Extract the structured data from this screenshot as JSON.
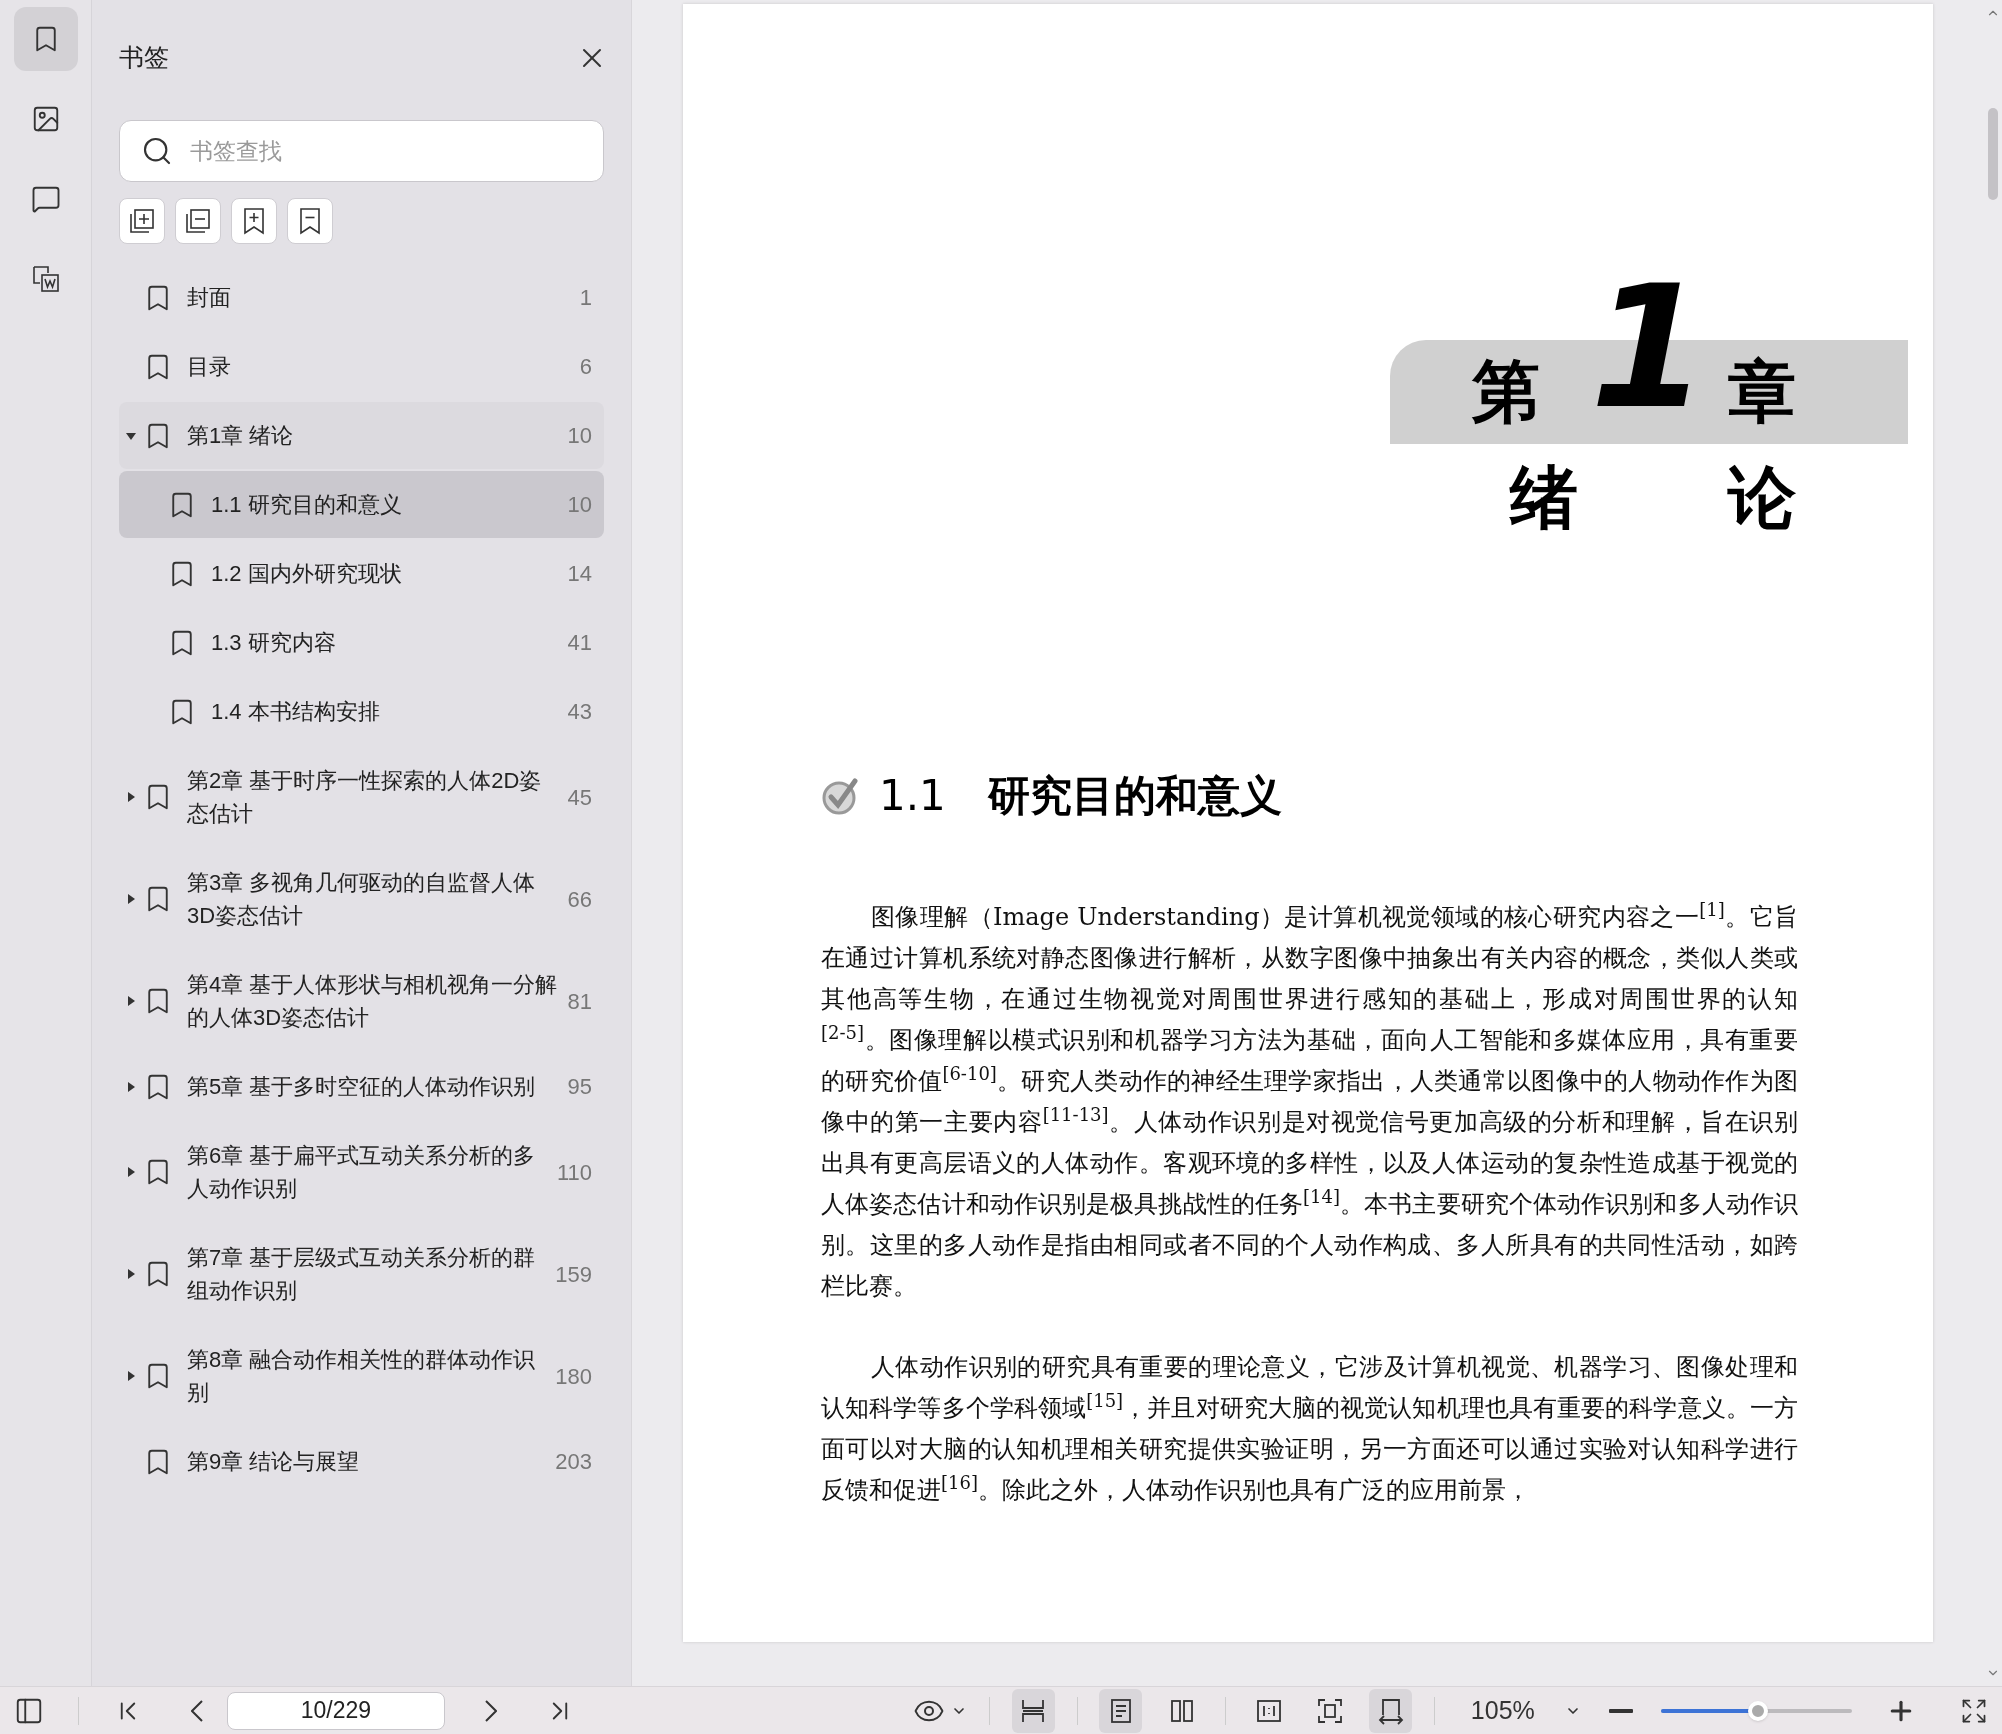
{
  "rail": [
    {
      "kind": "bookmarks",
      "selected": true
    },
    {
      "kind": "thumbnails",
      "selected": false
    },
    {
      "kind": "comments",
      "selected": false
    },
    {
      "kind": "convert",
      "selected": false
    }
  ],
  "sidebar": {
    "title": "书签",
    "search": {
      "placeholder": "书签查找"
    },
    "tools": [
      {
        "kind": "add-child"
      },
      {
        "kind": "remove-child"
      },
      {
        "kind": "add-bookmark"
      },
      {
        "kind": "remove-bookmark"
      }
    ],
    "items": [
      {
        "label": "封面",
        "page": "1",
        "selected": false,
        "highlighted": false
      },
      {
        "label": "目录",
        "page": "6",
        "selected": false,
        "highlighted": false
      },
      {
        "label": "第1章 绪论",
        "page": "10",
        "selected": false,
        "highlighted": true,
        "expanded": true,
        "children": [
          {
            "label": "1.1 研究目的和意义",
            "page": "10",
            "selected": true,
            "highlighted": false
          },
          {
            "label": "1.2 国内外研究现状",
            "page": "14",
            "selected": false,
            "highlighted": false
          },
          {
            "label": "1.3 研究内容",
            "page": "41",
            "selected": false,
            "highlighted": false
          },
          {
            "label": "1.4 本书结构安排",
            "page": "43",
            "selected": false,
            "highlighted": false
          }
        ]
      },
      {
        "label": "第2章 基于时序一性探索的人体2D姿态估计",
        "page": "45",
        "selected": false,
        "highlighted": false,
        "expanded": false
      },
      {
        "label": "第3章 多视角几何驱动的自监督人体3D姿态估计",
        "page": "66",
        "selected": false,
        "highlighted": false,
        "expanded": false
      },
      {
        "label": "第4章 基于人体形状与相机视角一分解的人体3D姿态估计",
        "page": "81",
        "selected": false,
        "highlighted": false,
        "expanded": false
      },
      {
        "label": "第5章 基于多时空征的人体动作识别",
        "page": "95",
        "selected": false,
        "highlighted": false,
        "expanded": false
      },
      {
        "label": "第6章 基于扁平式互动关系分析的多人动作识别",
        "page": "110",
        "selected": false,
        "highlighted": false,
        "expanded": false
      },
      {
        "label": "第7章 基于层级式互动关系分析的群组动作识别",
        "page": "159",
        "selected": false,
        "highlighted": false,
        "expanded": false
      },
      {
        "label": "第8章 融合动作相关性的群体动作识别",
        "page": "180",
        "selected": false,
        "highlighted": false,
        "expanded": false
      },
      {
        "label": "第9章 结论与展望",
        "page": "203",
        "selected": false,
        "highlighted": false
      }
    ]
  },
  "page": {
    "chapter_prefix": "第",
    "chapter_number": "1",
    "chapter_suffix": "章",
    "chapter_title": [
      "绪",
      "论"
    ],
    "section_number": "1.1",
    "section_title": "研究目的和意义",
    "paragraphs": [
      "图像理解（Image Understanding）是计算机视觉领域的核心研究内容之一$^{[1]}$。它旨在通过计算机系统对静态图像进行解析，从数字图像中抽象出有关内容的概念，类似人类或其他高等生物，在通过生物视觉对周围世界进行感知的基础上，形成对周围世界的认知$^{[2-5]}$。图像理解以模式识别和机器学习方法为基础，面向人工智能和多媒体应用，具有重要的研究价值$^{[6-10]}$。研究人类动作的神经生理学家指出，人类通常以图像中的人物动作作为图像中的第一主要内容$^{[11-13]}$。人体动作识别是对视觉信号更加高级的分析和理解，旨在识别出具有更高层语义的人体动作。客观环境的多样性，以及人体运动的复杂性造成基于视觉的人体姿态估计和动作识别是极具挑战性的任务$^{[14]}$。本书主要研究个体动作识别和多人动作识别。这里的多人动作是指由相同或者不同的个人动作构成、多人所具有的共同性活动，如跨栏比赛。",
      "人体动作识别的研究具有重要的理论意义，它涉及计算机视觉、机器学习、图像处理和认知科学等多个学科领域$^{[15]}$，并且对研究大脑的视觉认知机理也具有重要的科学意义。一方面可以对大脑的认知机理相关研究提供实验证明，另一方面还可以通过实验对认知科学进行反馈和促进$^{[16]}$。除此之外，人体动作识别也具有广泛的应用前景，"
    ]
  },
  "toolbar": {
    "page_field": "10/229",
    "view_groups": [
      [
        {
          "kind": "fit-width",
          "selected": true
        }
      ],
      [
        {
          "kind": "single-page",
          "selected": true
        },
        {
          "kind": "two-page",
          "selected": false
        }
      ],
      [
        {
          "kind": "actual-size",
          "selected": false
        },
        {
          "kind": "fit-page",
          "selected": false
        },
        {
          "kind": "rotate",
          "selected": true
        }
      ]
    ],
    "zoom": {
      "value": "105%",
      "level": 0.51
    }
  }
}
